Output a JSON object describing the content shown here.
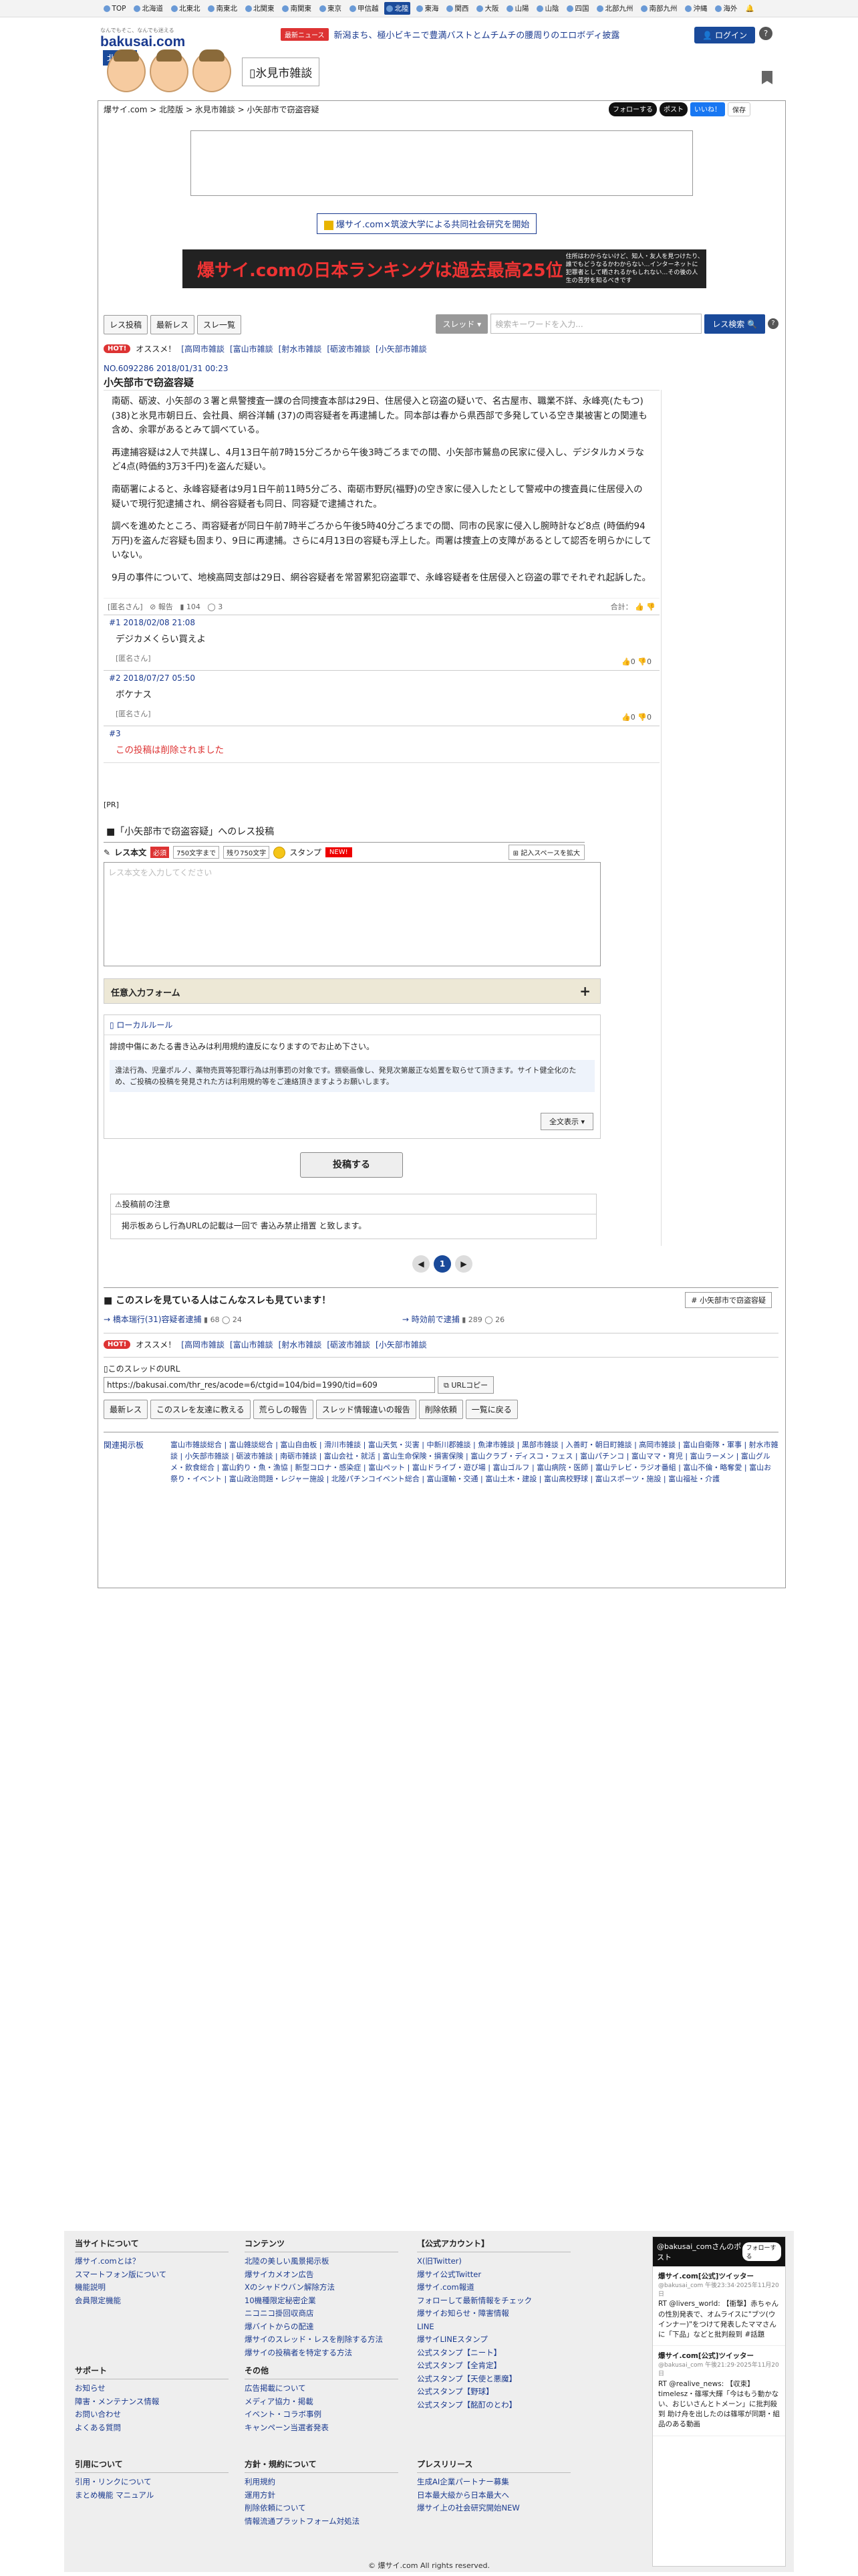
{
  "topnav": {
    "regions": [
      "TOP",
      "北海道",
      "北東北",
      "南東北",
      "北関東",
      "南関東",
      "東京",
      "甲信越",
      "北陸",
      "東海",
      "関西",
      "大阪",
      "山陽",
      "山陰",
      "四国",
      "北部九州",
      "南部九州",
      "沖縄",
      "海外"
    ],
    "selected": "北陸"
  },
  "header": {
    "site_tagline": "なんでもそこ、なんでも迷える",
    "logo": "bakusai.com",
    "region": "北陸版",
    "board_title": "氷見市雑談",
    "news_label": "最新ニュース",
    "news_text": "新潟まち、極小ビキニで豊満バストとムチムチの腰周りのエロボディ披露",
    "login": "ログイン"
  },
  "breadcrumb": "爆サイ.com > 北陸版 > 氷見市雑談 > 小矢部市で窃盗容疑",
  "social": {
    "follow": "フォローする",
    "post": "ポスト",
    "like": "いいね！",
    "save": "保存"
  },
  "research": "爆サイ.com×筑波大学による共同社会研究を開始",
  "banner": {
    "big": "爆サイ.comの日本ランキングは過去最高25位",
    "small": "住所はわからないけど、知人・友人を見つけたり、誰でもどうなるかわからない…インターネットに犯罪者として晒されるかもしれない…その後の人生の苦労を知るべきです"
  },
  "toolbar": {
    "btn1": "レス投稿",
    "btn2": "最新レス",
    "btn3": "スレ一覧",
    "select": "スレッド",
    "placeholder": "検索キーワードを入力...",
    "search": "レス検索"
  },
  "rec": {
    "label": "HOT!",
    "text": "オススメ！",
    "links": [
      "[高岡市雑談",
      "[富山市雑談",
      "[射水市雑談",
      "[砺波市雑談",
      "[小矢部市雑談"
    ]
  },
  "post": {
    "meta": "NO.6092286 2018/01/31 00:23",
    "title": "小矢部市で窃盗容疑",
    "paragraphs": [
      "南砺、砺波、小矢部の３署と県警捜査一課の合同捜査本部は29日、住居侵入と窃盗の疑いで、名古屋市、職業不詳、永峰亮(たもつ) (38)と氷見市朝日丘、会社員、網谷洋輔 (37)の両容疑者を再逮捕した。同本部は春から県西部で多発している空き巣被害との関連も含め、余罪があるとみて調べている。",
      "再逮捕容疑は2人で共謀し、4月13日午前7時15分ごろから午後3時ごろまでの間、小矢部市鷲島の民家に侵入し、デジタルカメラなど4点(時価約3万3千円)を盗んだ疑い。",
      "南砺署によると、永峰容疑者は9月1日午前11時5分ごろ、南砺市野尻(福野)の空き家に侵入したとして警戒中の捜査員に住居侵入の疑いで現行犯逮捕され、網谷容疑者も同日、同容疑で逮捕された。",
      "調べを進めたところ、両容疑者が同日午前7時半ごろから午後5時40分ごろまでの間、同市の民家に侵入し腕時計など8点 (時価約94万円)を盗んだ容疑も固まり、9日に再逮捕。さらに4月13日の容疑も浮上した。両署は捜査上の支障があるとして認否を明らかにしていない。",
      "9月の事件について、地検高岡支部は29日、網谷容疑者を常習累犯窃盗罪で、永峰容疑者を住居侵入と窃盗の罪でそれぞれ起訴した。"
    ],
    "author": "[匿名さん]",
    "report": "報告",
    "views": "104",
    "replies": "3",
    "total": "合計："
  },
  "replies": [
    {
      "meta": "#1 2018/02/08 21:08",
      "text": "デジカメくらい買えよ",
      "name": "[匿名さん]",
      "up": "0",
      "down": "0"
    },
    {
      "meta": "#2 2018/07/27 05:50",
      "text": "ボケナス",
      "name": "[匿名さん]",
      "up": "0",
      "down": "0"
    },
    {
      "meta": "#3",
      "text": "この投稿は削除されました",
      "name": "",
      "up": "",
      "down": ""
    }
  ],
  "form": {
    "pr": "[PR]",
    "title": "■「小矢部市で窃盗容疑」へのレス投稿",
    "label": "レス本文",
    "required": "必須",
    "limit": "750文字まで",
    "remaining": "残り750文字",
    "stamp": "スタンプ",
    "new": "NEW!",
    "expand": "記入スペースを拡大",
    "placeholder": "レス本文を入力してください",
    "optional": "任意入力フォーム",
    "local_rule": "ローカルルール",
    "local_text": "誹謗中傷にあたる書き込みは利用規約違反になりますのでお止め下さい。",
    "notice_text": "違法行為、児童ポルノ、薬物売買等犯罪行為は刑事罰の対象です。猥褻画像し、発見次第厳正な処置を取らせて頂きます。サイト健全化のため、ご投稿の投稿を発見された方は利用規約等をご連絡頂きますようお願いします。",
    "show_all": "全文表示",
    "submit": "投稿する",
    "caution_title": "投稿前の注意",
    "caution": "掲示板あらし行為URLの記載は一回で 書込み禁止措置 と致します。"
  },
  "pager": {
    "current": "1"
  },
  "also": {
    "title": "■ このスレを見ている人はこんなスレも見ています！",
    "tag": "小矢部市で窃盗容疑",
    "items": [
      {
        "t": "→ 橋本瑞行(31)容疑者逮捕",
        "v": "68",
        "c": "24"
      },
      {
        "t": "→ 時効前で逮捕",
        "v": "289",
        "c": "26"
      }
    ]
  },
  "url": {
    "label": "このスレッドのURL",
    "value": "https://bakusai.com/thr_res/acode=6/ctgid=104/bid=1990/tid=609",
    "copy": "URLコピー"
  },
  "actions": [
    "最新レス",
    "このスレを友達に教える",
    "荒らしの報告",
    "スレッド情報違いの報告",
    "削除依頼",
    "一覧に戻る"
  ],
  "cats": {
    "label": "関連掲示板",
    "text": "富山市雑談総合 | 富山雑談総合 | 富山自由板 | 滑川市雑談 | 富山天気・災害 | 中新川郡雑談 | 魚津市雑談 | 黒部市雑談 | 入善町・朝日町雑談 | 高岡市雑談 | 富山自衛隊・軍事 | 射水市雑談 | 小矢部市雑談 | 砺波市雑談 | 南砺市雑談 | 富山会社・就活 | 富山生命保険・損害保険 | 富山クラブ・ディスコ・フェス | 富山パチンコ | 富山ママ・育児 | 富山ラーメン | 富山グルメ・飲食総合 | 富山釣り・魚・漁協 | 新型コロナ・感染症 | 富山ペット | 富山ドライブ・遊び場 | 富山ゴルフ | 富山病院・医師 | 富山テレビ・ラジオ番組 | 富山不倫・略奪愛 | 富山お祭り・イベント | 富山政治問題・レジャー施設 | 北陸パチンコイベント総合 | 富山運輸・交通 | 富山土木・建設 | 富山高校野球 | 富山スポーツ・施設 | 富山福祉・介護"
  },
  "footer": {
    "col1_title": "当サイトについて",
    "col1": [
      "爆サイ.comとは？",
      "スマートフォン版について",
      "機能説明",
      "会員限定機能"
    ],
    "col2_title": "コンテンツ",
    "col2": [
      "北陸の美しい風景掲示板",
      "爆サイカメオン広告",
      "Xのシャドウバン解除方法",
      "10機種限定秘密企業",
      "ニコニコ掛回収商店",
      "爆バイトからの配達",
      "爆サイのスレッド・レスを削除する方法",
      "爆サイの投稿者を特定する方法"
    ],
    "col3_title": "【公式アカウント】",
    "col3": [
      "X(旧Twitter)",
      "爆サイ公式Twitter",
      "爆サイ.com報道",
      "フォローして最新情報をチェック",
      "爆サイお知らせ・障害情報",
      "LINE",
      "爆サイLINEスタンプ",
      "公式スタンプ【ニート】",
      "公式スタンプ【全肯定】",
      "公式スタンプ【天使と悪魔】",
      "公式スタンプ【野球】",
      "公式スタンプ【酩酊のとわ】"
    ],
    "col4_title": "サポート",
    "col4": [
      "お知らせ",
      "障害・メンテナンス情報",
      "お問い合わせ",
      "よくある質問"
    ],
    "col5_title": "その他",
    "col5": [
      "広告掲載について",
      "メディア協力・掲載",
      "イベント・コラボ事例",
      "キャンペーン当選者発表"
    ],
    "col6_title": "引用について",
    "col6": [
      "引用・リンクについて",
      "まとめ機能 マニュアル"
    ],
    "col7_title": "方針・規約について",
    "col7": [
      "利用規約",
      "運用方針",
      "削除依頼について",
      "情報流通プラットフォーム対処法"
    ],
    "col8_title": "プレスリリース",
    "col8": [
      "生成AI企業パートナー募集",
      "日本最大級から日本最大へ",
      "爆サイ上の社会研究開始NEW"
    ],
    "twitter_title": "@bakusai_comさんのポスト",
    "twitter_follow": "フォローする",
    "tweets": [
      {
        "name": "爆サイ.com[公式]ツイッター",
        "sub": "@bakusai_com 午後23:34·2025年11月20日",
        "text": "RT @livers_world: 【衝撃】赤ちゃんの性別発表で、オムライスに\"ブツ(ウインナー)\"をつけて発表したママさんに「下品」などと批判殺到 #話題"
      },
      {
        "name": "爆サイ.com[公式]ツイッター",
        "sub": "@bakusai_com 午後21:29·2025年11月20日",
        "text": "RT @realive_news: 【収束】timelesz・篠塚大輝「今はもう動かない、おじいさんとトメーン」に批判殺到 助け舟を出したのは篠塚が同期・組品のある動画"
      }
    ],
    "copyright": "© 爆サイ.com All rights reserved."
  }
}
